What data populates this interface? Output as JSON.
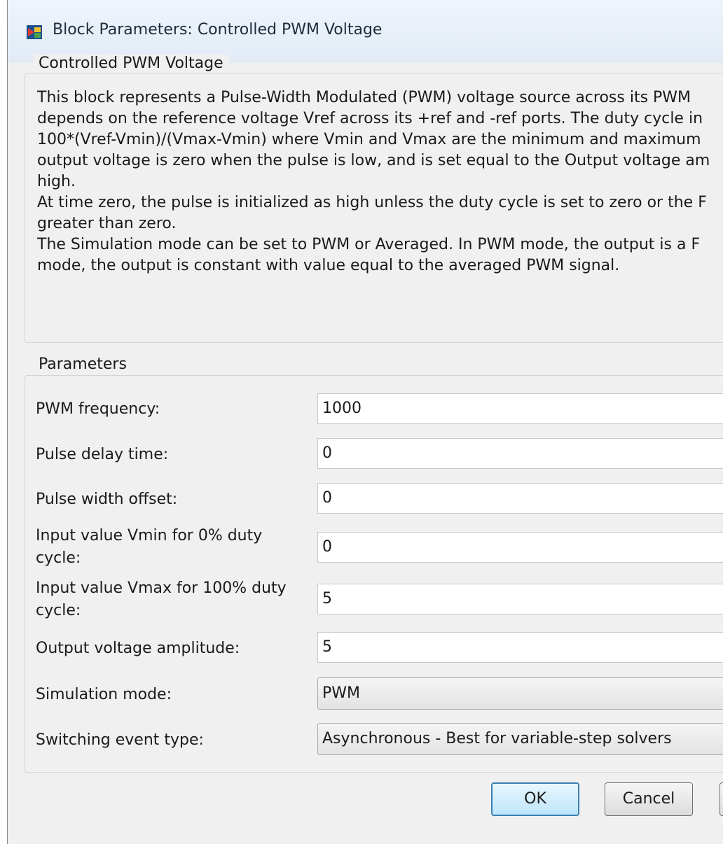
{
  "window": {
    "title": "Block Parameters: Controlled PWM Voltage"
  },
  "description_group": {
    "legend": "Controlled PWM Voltage",
    "paragraphs": [
      "This block represents a Pulse-Width Modulated (PWM) voltage source across its PWM",
      "depends on the reference voltage Vref across its +ref and -ref ports. The duty cycle in",
      "100*(Vref-Vmin)/(Vmax-Vmin) where Vmin and Vmax are the minimum and maximum",
      "output voltage is zero when the pulse is low, and is set equal to the Output voltage am",
      "high.",
      "",
      "At time zero, the pulse is initialized as high unless the duty cycle is set to zero or the F",
      "greater than zero.",
      "",
      "The Simulation mode can be set to PWM or Averaged. In PWM mode, the output is a F",
      "mode, the output is constant with value equal to the averaged PWM signal."
    ]
  },
  "parameters": {
    "legend": "Parameters",
    "pwm_frequency": {
      "label": "PWM frequency:",
      "value": "1000"
    },
    "pulse_delay_time": {
      "label": "Pulse delay time:",
      "value": "0"
    },
    "pulse_width_offset": {
      "label": "Pulse width offset:",
      "value": "0"
    },
    "vmin": {
      "label_line1": "Input value Vmin for 0% duty",
      "label_line2": "cycle:",
      "value": "0"
    },
    "vmax": {
      "label_line1": "Input value Vmax for 100% duty",
      "label_line2": "cycle:",
      "value": "5"
    },
    "output_voltage_amplitude": {
      "label": "Output voltage amplitude:",
      "value": "5"
    },
    "simulation_mode": {
      "label": "Simulation mode:",
      "selected": "PWM"
    },
    "switching_event_type": {
      "label": "Switching event type:",
      "selected": "Asynchronous - Best for variable-step solvers"
    }
  },
  "buttons": {
    "ok": "OK",
    "cancel": "Cancel"
  },
  "colors": {
    "dialog_bg": "#f0f0f0",
    "default_button_border": "#3c7fb1"
  },
  "icons": {
    "app": "simulink-block-icon"
  }
}
